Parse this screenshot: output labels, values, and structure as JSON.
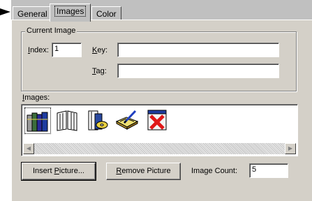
{
  "tabs": [
    {
      "label": "General",
      "active": false
    },
    {
      "label": "Images",
      "active": true
    },
    {
      "label": "Color",
      "active": false
    }
  ],
  "current_image": {
    "group_title": "Current Image",
    "index": {
      "label_mnemonic": "I",
      "label_rest": "ndex:",
      "value": "1"
    },
    "key": {
      "label_mnemonic": "K",
      "label_rest": "ey:",
      "value": ""
    },
    "tag": {
      "label_mnemonic": "T",
      "label_rest": "ag:",
      "value": ""
    }
  },
  "images_section": {
    "label_mnemonic": "I",
    "label_rest": "mages:",
    "items": [
      {
        "icon": "books-icon",
        "selected": true
      },
      {
        "icon": "open-book-icon",
        "selected": false
      },
      {
        "icon": "book-with-cd-icon",
        "selected": false
      },
      {
        "icon": "book-with-pen-icon",
        "selected": false
      },
      {
        "icon": "red-x-icon",
        "selected": false
      }
    ]
  },
  "buttons": {
    "insert": {
      "before": "Insert ",
      "mnemonic": "P",
      "after": "icture..."
    },
    "remove": {
      "before": "",
      "mnemonic": "R",
      "after": "emove Picture"
    }
  },
  "image_count": {
    "label": "Image Count:",
    "value": "5"
  },
  "colors": {
    "dialog_face": "#d4d0c8",
    "tab_strip": "#c0c0c0",
    "x_red": "#e01818"
  }
}
